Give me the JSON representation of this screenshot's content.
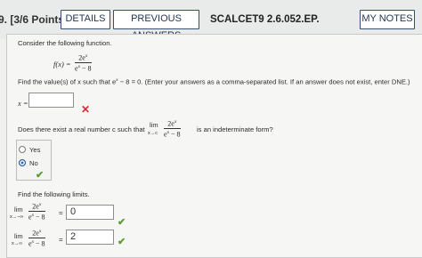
{
  "header": {
    "question_number": "9. [3/6 Points]",
    "details_label": "DETAILS",
    "previous_answers_label": "PREVIOUS ANSWERS",
    "code": "SCALCET9 2.6.052.EP.",
    "my_notes_label": "MY NOTES"
  },
  "body": {
    "intro": "Consider the following function.",
    "function_lhs": "f(x) =",
    "function_num": "2e",
    "function_den": "e",
    "function_den_tail": " − 8",
    "find_values": "Find the value(s) of x such that e",
    "find_values_tail": " − 8 = 0. (Enter your answers as a comma-separated list. If an answer does not exist, enter DNE.)",
    "x_label": "x =",
    "x_answer": "",
    "limit_question_a": "Does there exist a real number c such that",
    "limit_question_b": "is an indeterminate form?",
    "lim_word": "lim",
    "lim_sub_c": "x→c",
    "options": [
      "Yes",
      "No"
    ],
    "selected_option": "No",
    "find_limits": "Find the following limits.",
    "lim_sub_neg": "x→−∞",
    "lim_sub_pos": "x→∞",
    "limit1_answer": "0",
    "limit2_answer": "2"
  },
  "colors": {
    "button_border": "#34506e",
    "error": "#d9292c",
    "correct": "#5c9c32",
    "radio_selected": "#2f6fd1"
  }
}
